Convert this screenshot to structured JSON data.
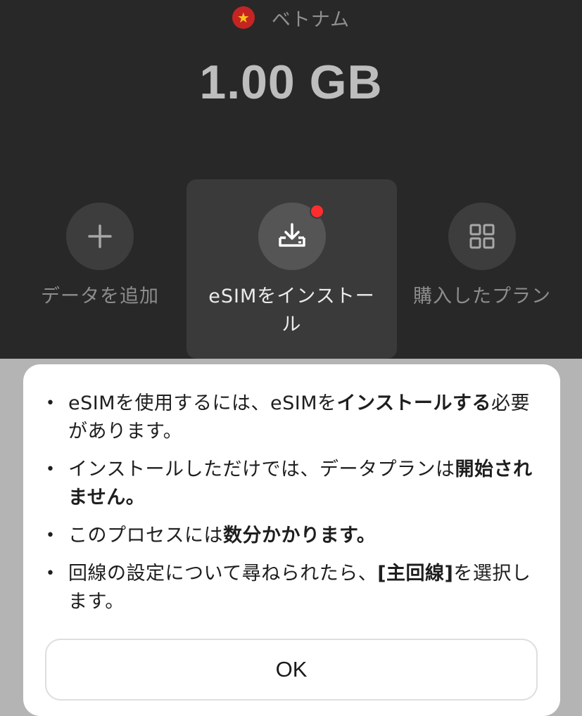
{
  "country": {
    "name": "ベトナム",
    "flag_icon": "vietnam-flag-icon"
  },
  "data_amount": "1.00 GB",
  "actions": [
    {
      "label": "データを追加",
      "icon": "plus-icon"
    },
    {
      "label": "eSIMをインストール",
      "icon": "download-tray-icon",
      "notification": true
    },
    {
      "label": "購入したプラン",
      "icon": "grid-icon"
    }
  ],
  "sheet": {
    "notes": [
      {
        "parts": [
          {
            "text": "eSIMを使用するには、eSIMを"
          },
          {
            "text": "インストールする",
            "bold": true
          },
          {
            "text": "必要があります。"
          }
        ]
      },
      {
        "parts": [
          {
            "text": "インストールしただけでは、データプランは"
          },
          {
            "text": "開始されません。",
            "bold": true
          }
        ]
      },
      {
        "parts": [
          {
            "text": "このプロセスには"
          },
          {
            "text": "数分かかります。",
            "bold": true
          }
        ]
      },
      {
        "parts": [
          {
            "text": "回線の設定について尋ねられたら、"
          },
          {
            "text": "[主回線]",
            "bold": true
          },
          {
            "text": "を選択します。"
          }
        ]
      }
    ],
    "ok_label": "OK"
  },
  "colors": {
    "top_background": "#282828",
    "overlay": "#b4b4b4",
    "badge": "#ff2d2d"
  }
}
